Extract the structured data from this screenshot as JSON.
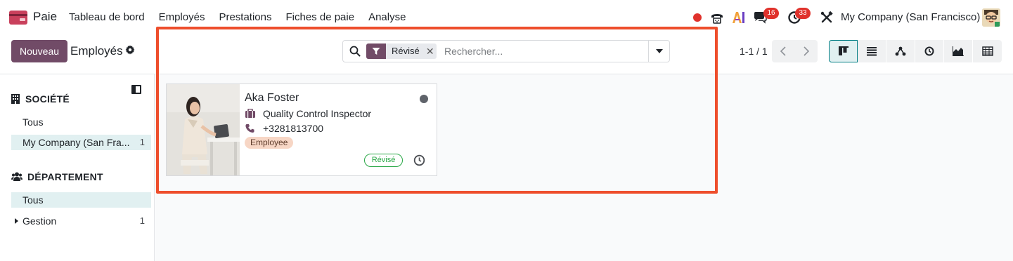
{
  "navbar": {
    "app_name": "Paie",
    "menu": [
      "Tableau de bord",
      "Employés",
      "Prestations",
      "Fiches de paie",
      "Analyse"
    ],
    "messages_badge": "16",
    "activities_badge": "33",
    "company": "My Company (San Francisco)"
  },
  "control_panel": {
    "new_button": "Nouveau",
    "title": "Employés",
    "search": {
      "facet_label": "Révisé",
      "placeholder": "Rechercher..."
    },
    "pager": "1-1 / 1",
    "views": [
      "kanban",
      "list",
      "hierarchy",
      "activity",
      "graph",
      "pivot"
    ],
    "active_view": "kanban"
  },
  "sidebar": {
    "company_section": {
      "title": "SOCIÉTÉ",
      "items": [
        {
          "label": "Tous",
          "count": ""
        },
        {
          "label": "My Company (San Fra...",
          "count": "1"
        }
      ]
    },
    "department_section": {
      "title": "DÉPARTEMENT",
      "items": [
        {
          "label": "Tous",
          "count": ""
        },
        {
          "label": "Gestion",
          "count": "1"
        }
      ]
    }
  },
  "cards": [
    {
      "name": "Aka Foster",
      "job": "Quality Control Inspector",
      "phone": "+3281813700",
      "tag": "Employee",
      "badge": "Révisé"
    }
  ],
  "colors": {
    "brand": "#714b67",
    "active_bg": "#e1f0f1",
    "highlight": "#ee4e2c",
    "badge_red": "#e0322c",
    "revised_green": "#28a745"
  }
}
